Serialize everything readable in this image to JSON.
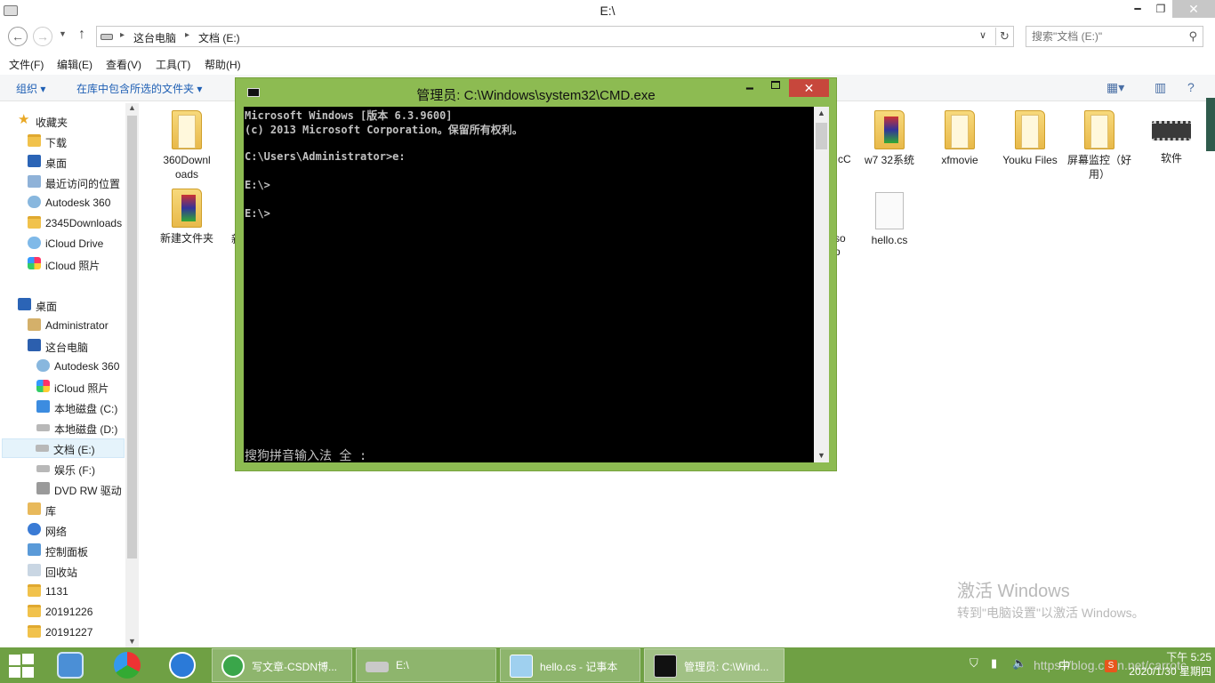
{
  "explorer": {
    "title": "E:\\",
    "titlebar_buttons": {
      "minimize": "━",
      "maximize": "❐",
      "close": "✕"
    },
    "breadcrumb": [
      "这台电脑",
      "文档 (E:)"
    ],
    "search_placeholder": "搜索\"文档 (E:)\"",
    "menu": [
      "文件(F)",
      "编辑(E)",
      "查看(V)",
      "工具(T)",
      "帮助(H)"
    ],
    "toolbar": {
      "organize": "组织 ▾",
      "include_library": "在库中包含所选的文件夹 ▾"
    },
    "nav": {
      "favorites_header": "收藏夹",
      "favorites": [
        "下载",
        "桌面",
        "最近访问的位置",
        "Autodesk 360",
        "2345Downloads",
        "iCloud Drive",
        "iCloud 照片"
      ],
      "desktop_header": "桌面",
      "desktop_items": [
        "Administrator",
        "这台电脑"
      ],
      "computer_items": [
        "Autodesk 360",
        "iCloud 照片",
        "本地磁盘 (C:)",
        "本地磁盘 (D:)",
        "文档 (E:)",
        "娱乐 (F:)",
        "DVD RW 驱动"
      ],
      "other_items": [
        "库",
        "网络",
        "控制面板",
        "回收站",
        "1131",
        "20191226",
        "20191227"
      ]
    },
    "files": [
      {
        "name": "360Downl oads",
        "icon": "folder"
      },
      {
        "name": "新建文件夹",
        "icon": "folder-image"
      },
      {
        "name": "w7  32系统",
        "icon": "folder-image"
      },
      {
        "name": "xfmovie",
        "icon": "folder"
      },
      {
        "name": "Youku Files",
        "icon": "folder"
      },
      {
        "name": "屏幕监控（好用）",
        "icon": "folder"
      },
      {
        "name": "软件",
        "icon": "chip"
      },
      {
        "name": "hello.cs",
        "icon": "file"
      }
    ],
    "partial_labels": {
      "a": "新",
      "b": "cC",
      "c": "so",
      "d": "p"
    }
  },
  "cmd": {
    "title": "管理员: C:\\Windows\\system32\\CMD.exe",
    "lines": [
      "Microsoft Windows [版本 6.3.9600]",
      "(c) 2013 Microsoft Corporation。保留所有权利。",
      "",
      "C:\\Users\\Administrator>e:",
      "",
      "E:\\>",
      "",
      "E:\\>"
    ],
    "ime_status": "搜狗拼音输入法 全 :"
  },
  "watermark": {
    "line1": "激活 Windows",
    "line2": "转到\"电脑设置\"以激活 Windows。"
  },
  "taskbar": {
    "tasks": [
      "写文章-CSDN博...",
      "E:\\",
      "hello.cs - 记事本",
      "管理员: C:\\Wind..."
    ],
    "time": "下午 5:25",
    "date": "2020/1/30 星期四",
    "ime_lang": "中",
    "url_watermark": "https://blog.csdn.net/carrotc",
    "sogou": "S"
  },
  "colors": {
    "taskbar": "#6fa044",
    "cmd_frame": "#8dbb52",
    "cmd_close": "#c7473c",
    "link_blue": "#1e5fb4"
  }
}
